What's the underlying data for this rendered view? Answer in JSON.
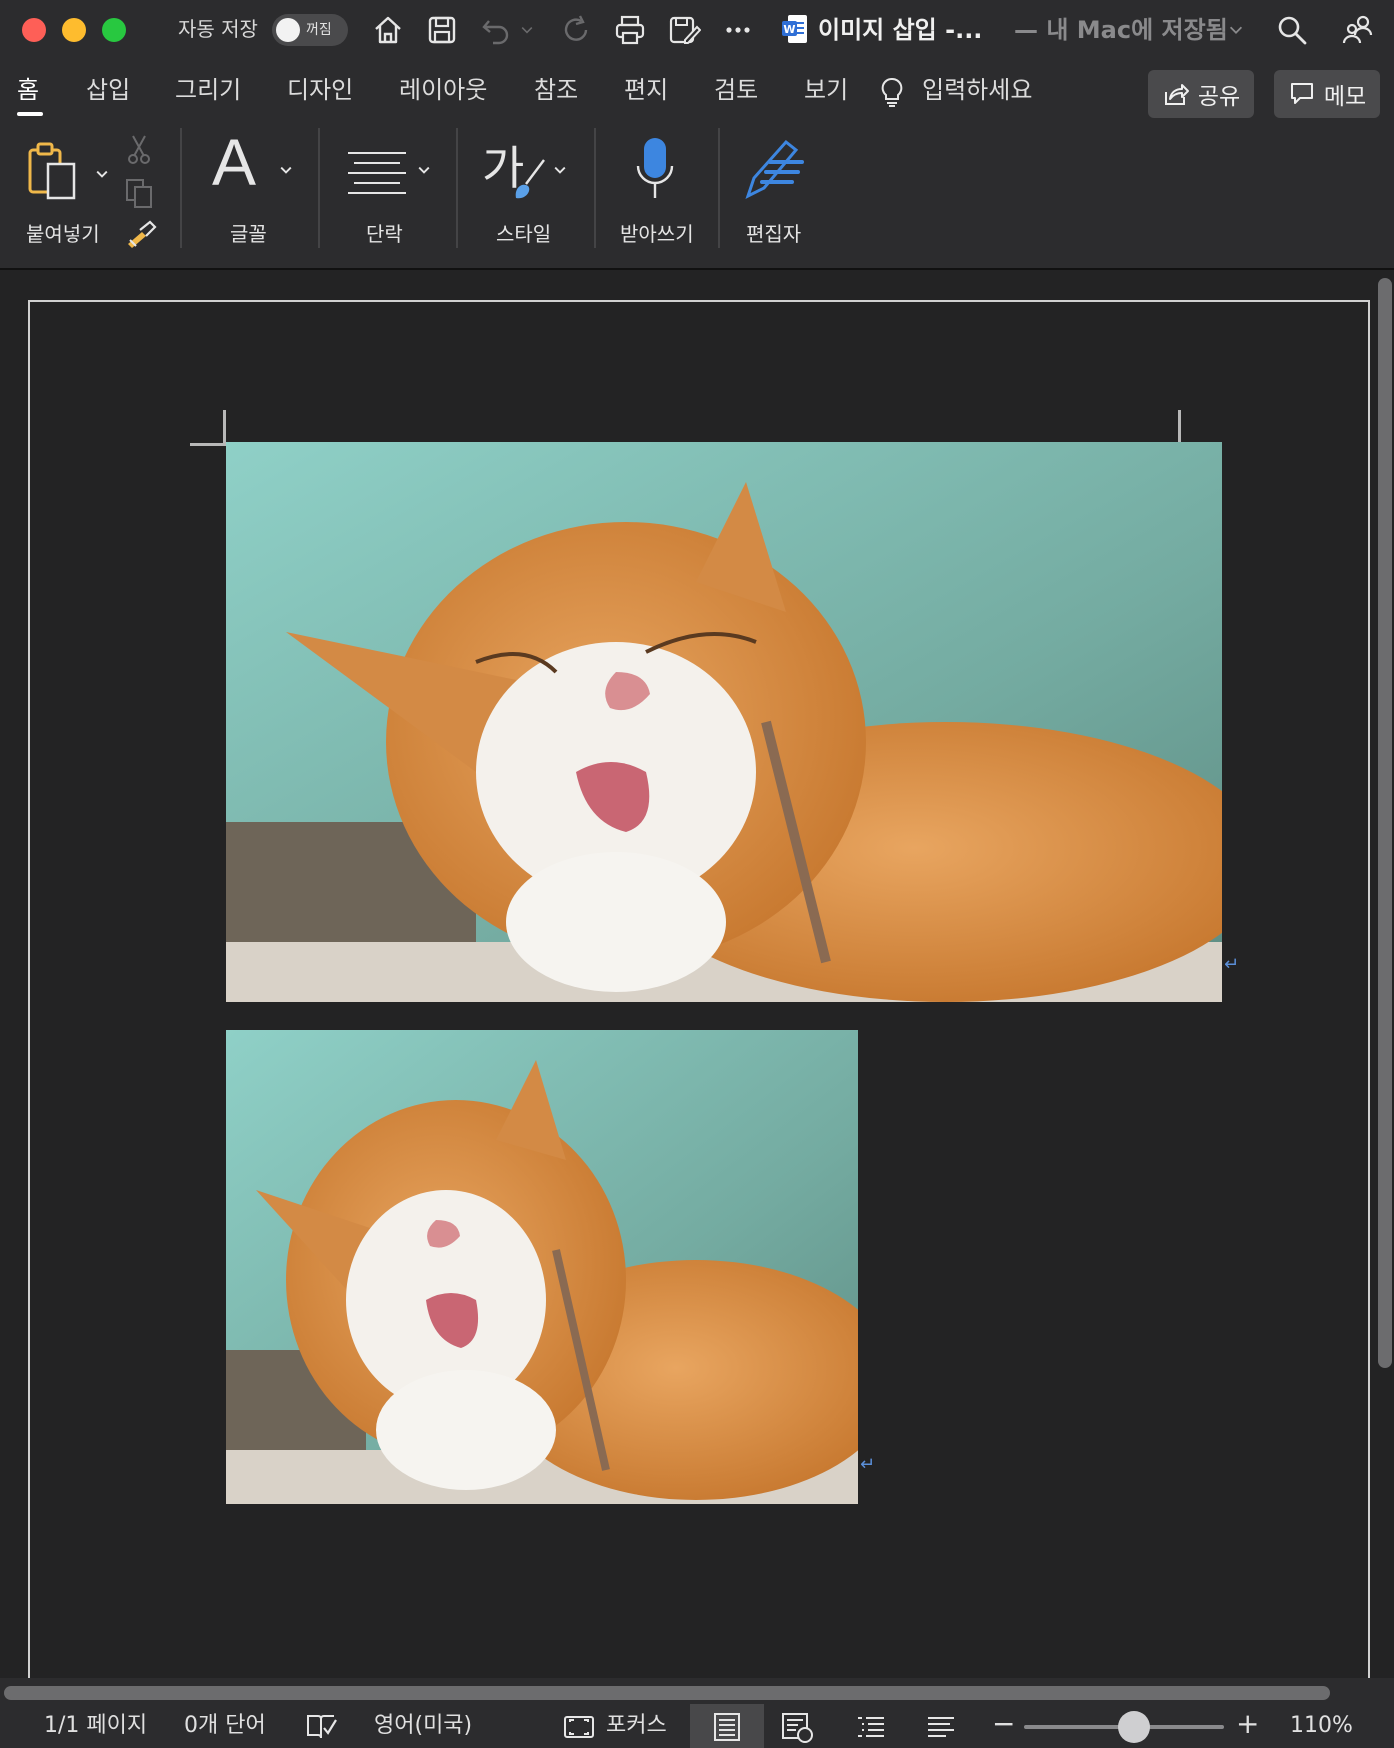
{
  "titlebar": {
    "autosave_label": "자동 저장",
    "autosave_state": "꺼짐",
    "doc_title": "이미지 삽입 -...",
    "doc_location": "— 내 Mac에 저장됨",
    "icons": [
      "home-icon",
      "save-icon",
      "undo-icon",
      "redo-icon",
      "print-icon",
      "save-as-icon",
      "more-icon",
      "search-icon",
      "share-people-icon"
    ]
  },
  "tabs": {
    "items": [
      "홈",
      "삽입",
      "그리기",
      "디자인",
      "레이아웃",
      "참조",
      "편지",
      "검토",
      "보기"
    ],
    "active": "홈",
    "tell_me": "입력하세요",
    "share_label": "공유",
    "comments_label": "메모"
  },
  "ribbon": {
    "paste": "붙여넣기",
    "font": "글꼴",
    "paragraph": "단락",
    "styles": "스타일",
    "dictate": "받아쓰기",
    "editor": "편집자",
    "styles_glyph": "가",
    "font_glyph": "A"
  },
  "document": {
    "images": [
      {
        "name": "cat-photo-large"
      },
      {
        "name": "cat-photo-small"
      }
    ],
    "paragraph_mark": "↵"
  },
  "status": {
    "page": "1/1 페이지",
    "words": "0개 단어",
    "language": "영어(미국)",
    "focus": "포커스",
    "zoom_minus": "−",
    "zoom_plus": "+",
    "zoom": "110%",
    "zoom_level_fraction": 0.55
  },
  "colors": {
    "accent_blue": "#2f6fd6",
    "close": "#fe5f57",
    "minimize": "#febc2e",
    "maximize": "#28c840"
  }
}
